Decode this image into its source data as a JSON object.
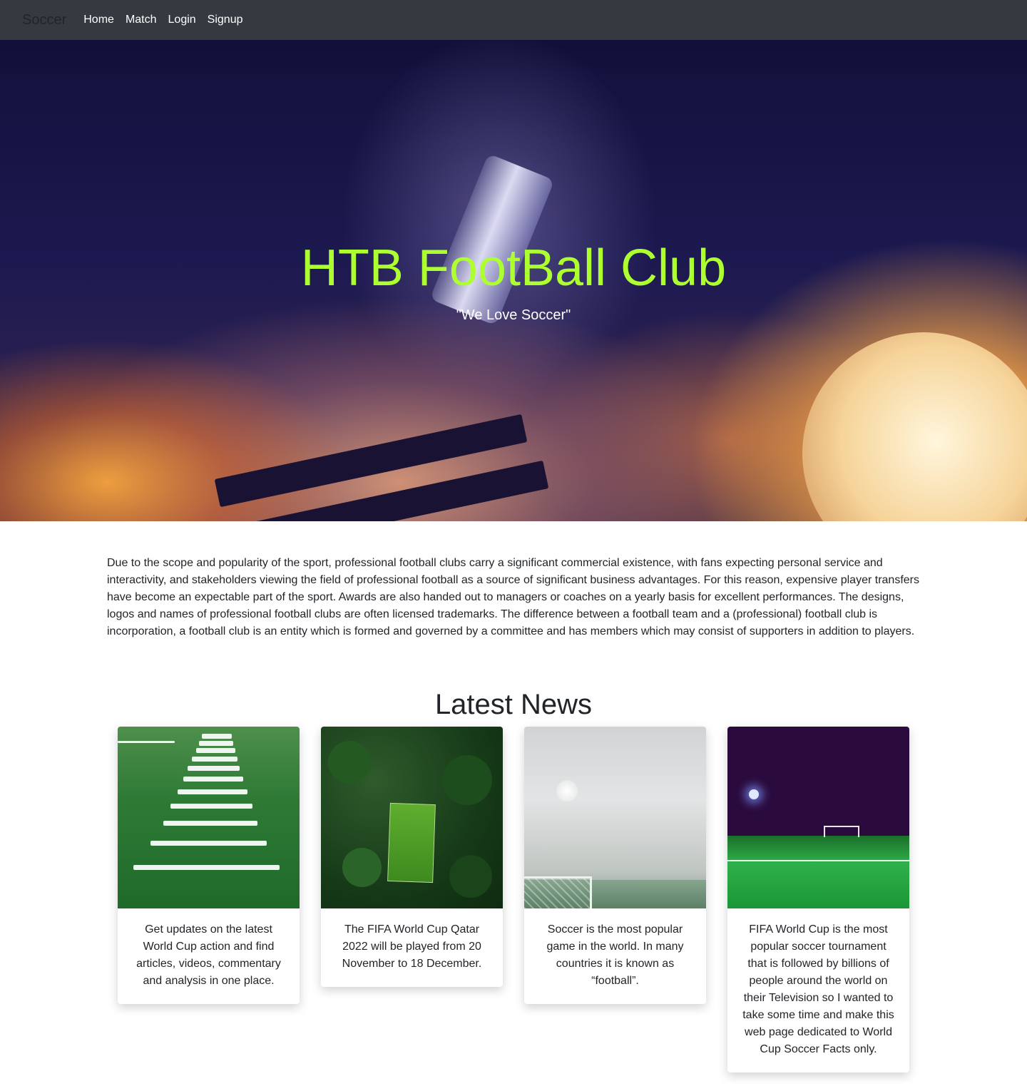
{
  "nav": {
    "brand": "Soccer",
    "links": [
      "Home",
      "Match",
      "Login",
      "Signup"
    ]
  },
  "hero": {
    "title": "HTB FootBall Club",
    "subtitle": "\"We Love Soccer\"",
    "title_color": "#adff2f"
  },
  "intro": {
    "text": "Due to the scope and popularity of the sport, professional football clubs carry a significant commercial existence, with fans expecting personal service and interactivity, and stakeholders viewing the field of professional football as a source of significant business advantages. For this reason, expensive player transfers have become an expectable part of the sport. Awards are also handed out to managers or coaches on a yearly basis for excellent performances. The designs, logos and names of professional football clubs are often licensed trademarks. The difference between a football team and a (professional) football club is incorporation, a football club is an entity which is formed and governed by a committee and has members which may consist of supporters in addition to players."
  },
  "news": {
    "heading": "Latest News",
    "cards": [
      {
        "text": "Get updates on the latest World Cup action and find articles, videos, commentary and analysis in one place."
      },
      {
        "text": "The FIFA World Cup Qatar 2022 will be played from 20 November to 18 December."
      },
      {
        "text": "Soccer is the most popular game in the world. In many countries it is known as “football”."
      },
      {
        "text": "FIFA World Cup is the most popular soccer tournament that is followed by billions of people around the world on their Television so I wanted to take some time and make this web page dedicated to World Cup Soccer Facts only."
      }
    ]
  },
  "colors": {
    "navbar_bg": "#343a40",
    "hero_title": "#adff2f"
  }
}
